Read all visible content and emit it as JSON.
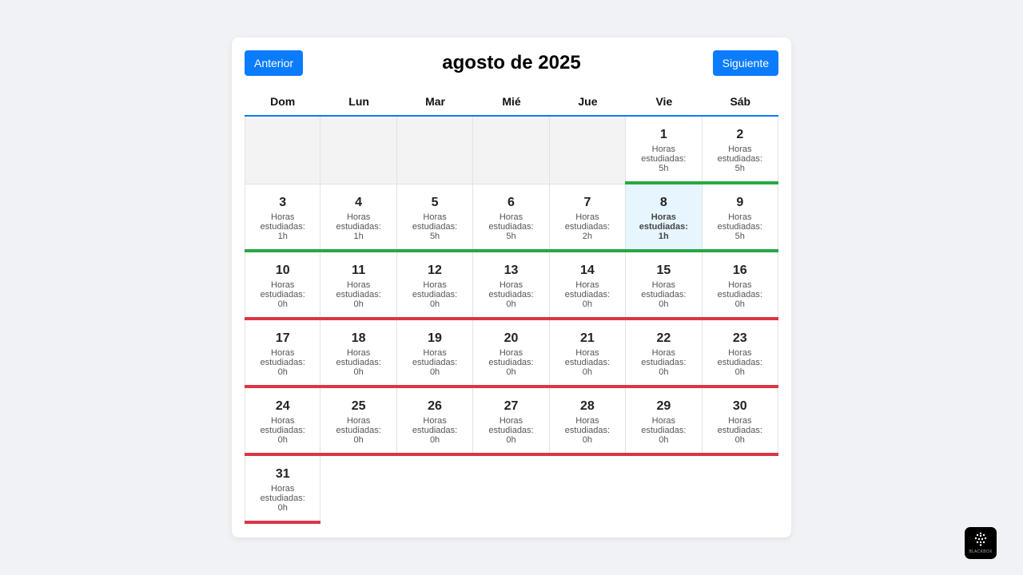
{
  "calendar": {
    "prev_label": "Anterior",
    "next_label": "Siguiente",
    "title": "agosto de 2025",
    "weekdays": [
      "Dom",
      "Lun",
      "Mar",
      "Mié",
      "Jue",
      "Vie",
      "Sáb"
    ],
    "leading_empty_days": 5,
    "today": 8,
    "hours_label": "Horas estudiadas:",
    "days": [
      {
        "day": "1",
        "hours": "5h",
        "status": "good"
      },
      {
        "day": "2",
        "hours": "5h",
        "status": "good"
      },
      {
        "day": "3",
        "hours": "1h",
        "status": "good"
      },
      {
        "day": "4",
        "hours": "1h",
        "status": "good"
      },
      {
        "day": "5",
        "hours": "5h",
        "status": "good"
      },
      {
        "day": "6",
        "hours": "5h",
        "status": "good"
      },
      {
        "day": "7",
        "hours": "2h",
        "status": "good"
      },
      {
        "day": "8",
        "hours": "1h",
        "status": "good"
      },
      {
        "day": "9",
        "hours": "5h",
        "status": "good"
      },
      {
        "day": "10",
        "hours": "0h",
        "status": "bad"
      },
      {
        "day": "11",
        "hours": "0h",
        "status": "bad"
      },
      {
        "day": "12",
        "hours": "0h",
        "status": "bad"
      },
      {
        "day": "13",
        "hours": "0h",
        "status": "bad"
      },
      {
        "day": "14",
        "hours": "0h",
        "status": "bad"
      },
      {
        "day": "15",
        "hours": "0h",
        "status": "bad"
      },
      {
        "day": "16",
        "hours": "0h",
        "status": "bad"
      },
      {
        "day": "17",
        "hours": "0h",
        "status": "bad"
      },
      {
        "day": "18",
        "hours": "0h",
        "status": "bad"
      },
      {
        "day": "19",
        "hours": "0h",
        "status": "bad"
      },
      {
        "day": "20",
        "hours": "0h",
        "status": "bad"
      },
      {
        "day": "21",
        "hours": "0h",
        "status": "bad"
      },
      {
        "day": "22",
        "hours": "0h",
        "status": "bad"
      },
      {
        "day": "23",
        "hours": "0h",
        "status": "bad"
      },
      {
        "day": "24",
        "hours": "0h",
        "status": "bad"
      },
      {
        "day": "25",
        "hours": "0h",
        "status": "bad"
      },
      {
        "day": "26",
        "hours": "0h",
        "status": "bad"
      },
      {
        "day": "27",
        "hours": "0h",
        "status": "bad"
      },
      {
        "day": "28",
        "hours": "0h",
        "status": "bad"
      },
      {
        "day": "29",
        "hours": "0h",
        "status": "bad"
      },
      {
        "day": "30",
        "hours": "0h",
        "status": "bad"
      },
      {
        "day": "31",
        "hours": "0h",
        "status": "bad"
      }
    ]
  },
  "colors": {
    "accent": "#0a7cff",
    "good": "#28a745",
    "bad": "#dc3545",
    "today_bg": "#e6f5ff"
  },
  "logo": {
    "icon": "blackbox-logo-icon",
    "text": "BLACKBOX"
  }
}
